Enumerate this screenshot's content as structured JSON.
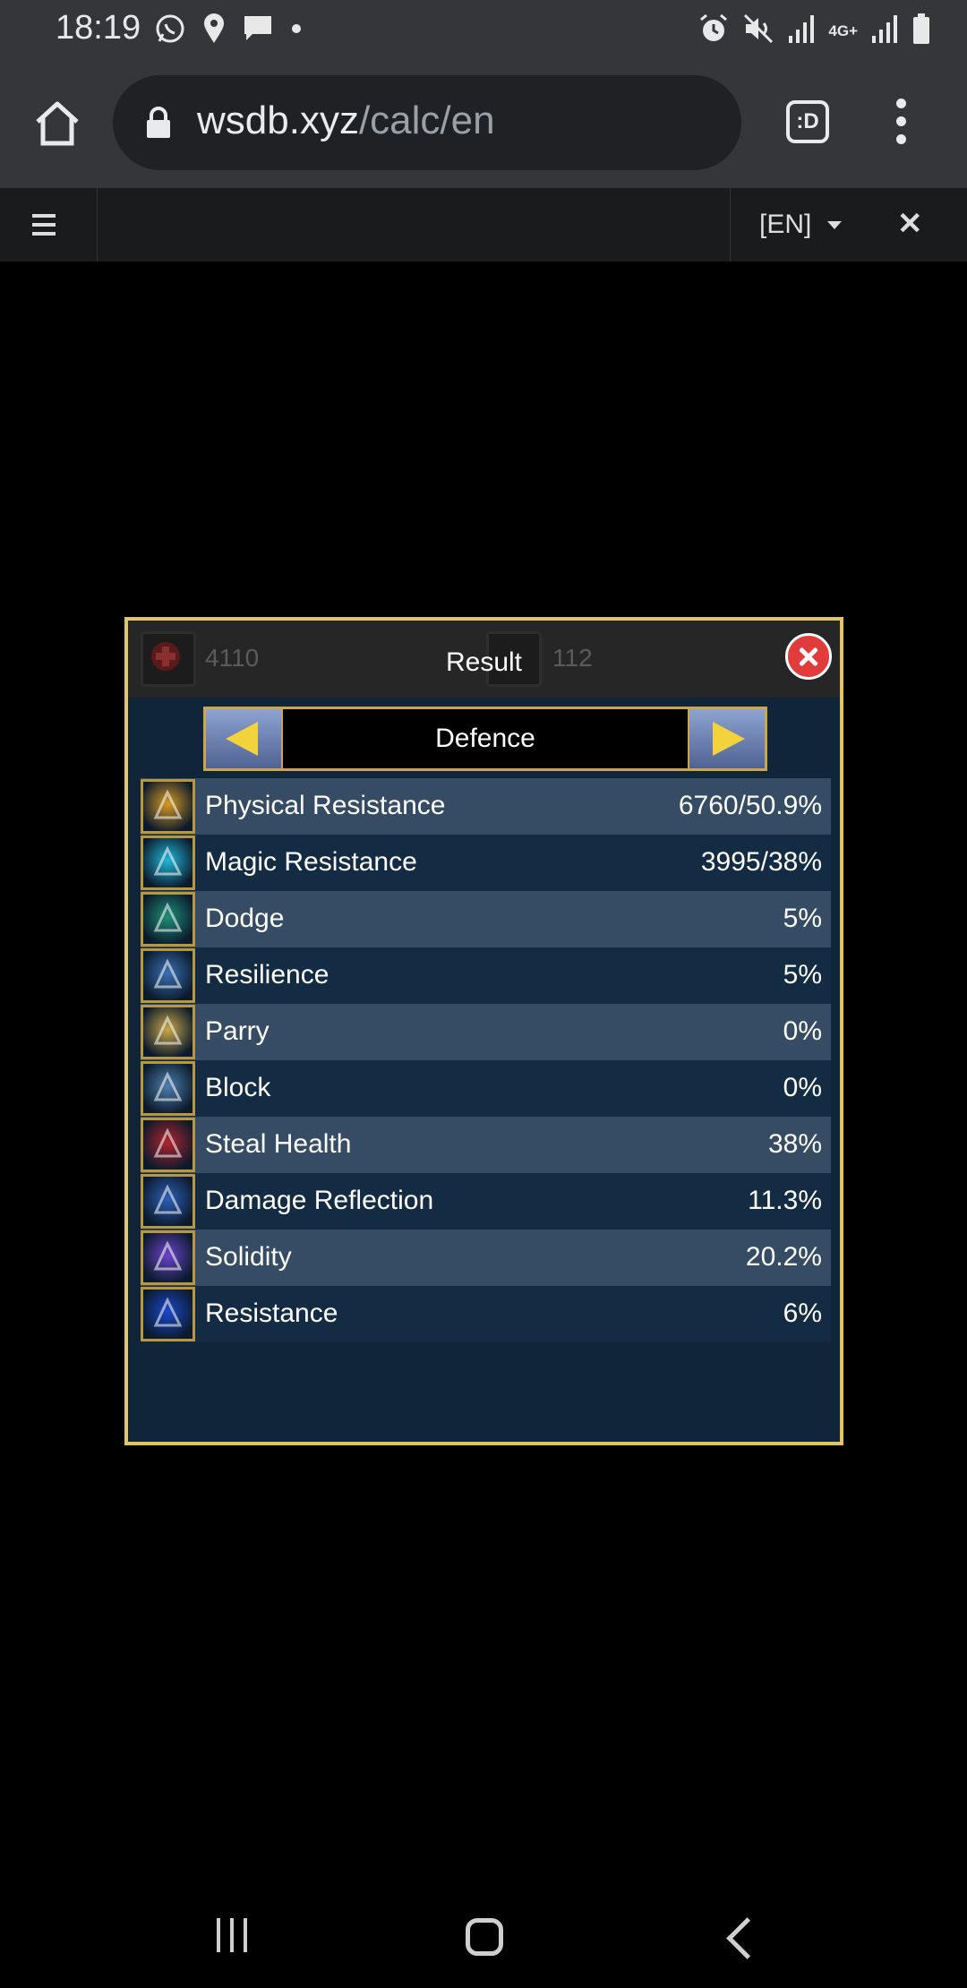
{
  "status_bar": {
    "time": "18:19",
    "left_icons": [
      "whatsapp-icon",
      "location-icon",
      "message-icon",
      "dot-icon"
    ],
    "right_icons": [
      "alarm-icon",
      "mute-icon",
      "signal-icon",
      "4g-icon",
      "signal-icon",
      "battery-icon"
    ],
    "network_label": "4G+"
  },
  "browser": {
    "url_domain": "wsdb.xyz",
    "url_path": "/calc/en",
    "tabs_label": ":D"
  },
  "site_nav": {
    "language": "[EN]"
  },
  "modal": {
    "title": "Result",
    "category": "Defence",
    "background_ghost": {
      "left_value": "4110",
      "right_value": "112"
    },
    "stats": [
      {
        "name": "Physical Resistance",
        "value": "6760/50.9%",
        "icon": "physical-resistance-icon",
        "color": "#d79a24"
      },
      {
        "name": "Magic Resistance",
        "value": "3995/38%",
        "icon": "magic-resistance-icon",
        "color": "#22b7d8"
      },
      {
        "name": "Dodge",
        "value": "5%",
        "icon": "dodge-icon",
        "color": "#1f8f78"
      },
      {
        "name": "Resilience",
        "value": "5%",
        "icon": "resilience-icon",
        "color": "#3a6fb3"
      },
      {
        "name": "Parry",
        "value": "0%",
        "icon": "parry-icon",
        "color": "#c9a74a"
      },
      {
        "name": "Block",
        "value": "0%",
        "icon": "block-icon",
        "color": "#4e7fae"
      },
      {
        "name": "Steal Health",
        "value": "38%",
        "icon": "steal-health-icon",
        "color": "#b0242d"
      },
      {
        "name": "Damage Reflection",
        "value": "11.3%",
        "icon": "damage-reflection-icon",
        "color": "#2d5fb8"
      },
      {
        "name": "Solidity",
        "value": "20.2%",
        "icon": "solidity-icon",
        "color": "#6b44c9"
      },
      {
        "name": "Resistance",
        "value": "6%",
        "icon": "resistance-icon",
        "color": "#1b47c9"
      }
    ]
  },
  "colors": {
    "modal_border": "#e2c56a",
    "close_button": "#e23b3b",
    "chrome_bar": "#35363a"
  }
}
